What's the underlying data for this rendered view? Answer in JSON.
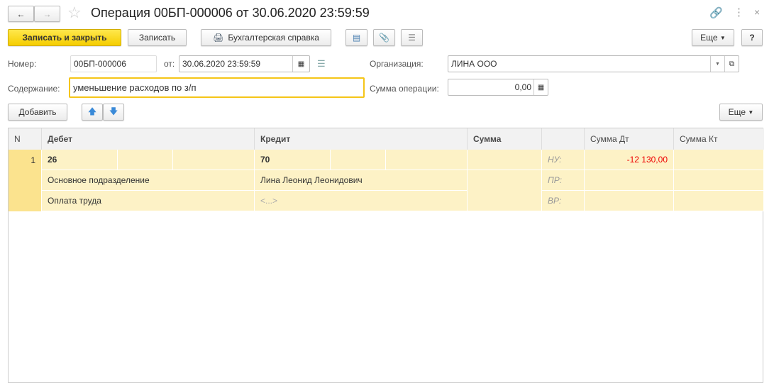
{
  "title": "Операция 00БП-000006 от 30.06.2020 23:59:59",
  "toolbar": {
    "save_close": "Записать и закрыть",
    "save": "Записать",
    "report": "Бухгалтерская справка",
    "more": "Еще",
    "help": "?"
  },
  "form": {
    "number_label": "Номер:",
    "number": "00БП-000006",
    "date_label": "от:",
    "date": "30.06.2020 23:59:59",
    "org_label": "Организация:",
    "org": "ЛИНА ООО",
    "content_label": "Содержание:",
    "content": "уменьшение расходов по з/п",
    "sum_label": "Сумма операции:",
    "sum": "0,00"
  },
  "table_toolbar": {
    "add": "Добавить",
    "more": "Еще"
  },
  "table": {
    "headers": {
      "n": "N",
      "debit": "Дебет",
      "credit": "Кредит",
      "sum": "Сумма",
      "sum_dt": "Сумма Дт",
      "sum_kt": "Сумма Кт"
    },
    "row": {
      "n": "1",
      "debit_account": "26",
      "credit_account": "70",
      "debit_sub1": "Основное подразделение",
      "debit_sub2": "Оплата труда",
      "credit_sub1": "Лина Леонид Леонидович",
      "credit_sub2": "<...>",
      "labels": [
        "НУ:",
        "ПР:",
        "ВР:"
      ],
      "sum_dt_nu": "-12 130,00"
    }
  }
}
